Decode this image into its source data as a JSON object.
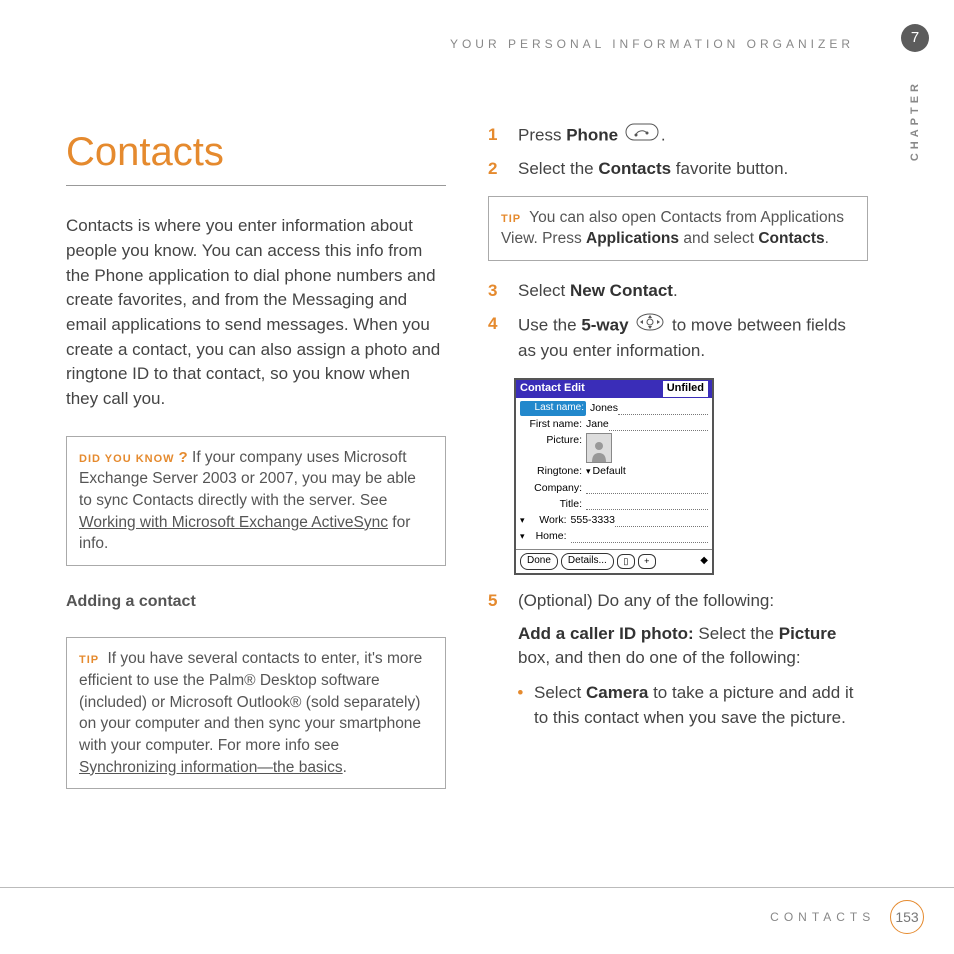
{
  "header": {
    "running_head": "YOUR PERSONAL INFORMATION ORGANIZER",
    "chapter_number": "7",
    "chapter_label": "CHAPTER"
  },
  "left": {
    "title": "Contacts",
    "intro": "Contacts is where you enter information about people you know. You can access this info from the Phone application to dial phone numbers and create favorites, and from the Messaging and email applications to send messages. When you create a contact, you can also assign a photo and ringtone ID to that contact, so you know when they call you.",
    "dyk_tag": "DID YOU KNOW",
    "dyk_text_pre": "If your company uses Microsoft Exchange Server 2003 or 2007, you may be able to sync Contacts directly with the server. See ",
    "dyk_link": "Working with Microsoft Exchange ActiveSync",
    "dyk_after": " for info.",
    "subhead": "Adding a contact",
    "tip_tag": "TIP",
    "tip_text_pre": "If you have several contacts to enter, it's more efficient to use the Palm® Desktop software (included) or Microsoft Outlook® (sold separately) on your computer and then sync your smartphone with your computer. For more info see ",
    "tip_link": "Synchronizing information—the basics",
    "tip_after": "."
  },
  "right": {
    "s1_a": "Press ",
    "s1_b": "Phone",
    "s1_c": ".",
    "s2_a": "Select the ",
    "s2_b": "Contacts",
    "s2_c": " favorite button.",
    "tipbox_tag": "TIP",
    "tipbox_a": "You can also open Contacts from Applications View. Press ",
    "tipbox_b": "Applications",
    "tipbox_c": " and select ",
    "tipbox_d": "Contacts",
    "tipbox_e": ".",
    "s3_a": "Select ",
    "s3_b": "New Contact",
    "s3_c": ".",
    "s4_a": "Use the ",
    "s4_b": "5-way",
    "s4_c": " to move between fields as you enter information.",
    "s5_a": "(Optional)  Do any of the following:",
    "s5_h1": "Add a caller ID photo:",
    "s5_h1_rest": " Select the ",
    "s5_h1_b": "Picture",
    "s5_h1_after": " box, and then do one of the following:",
    "bullet1_a": "Select ",
    "bullet1_b": "Camera",
    "bullet1_c": " to take a picture and add it to this contact when you save the picture."
  },
  "palm": {
    "title": "Contact Edit",
    "category": "Unfiled",
    "lastname_lbl": "Last name:",
    "lastname_val": "Jones",
    "firstname_lbl": "First name:",
    "firstname_val": "Jane",
    "picture_lbl": "Picture:",
    "ringtone_lbl": "Ringtone:",
    "ringtone_val": "Default",
    "company_lbl": "Company:",
    "title_lbl": "Title:",
    "work_lbl": "Work:",
    "work_val": "555-3333",
    "home_lbl": "Home:",
    "done": "Done",
    "details": "Details..."
  },
  "footer": {
    "label": "CONTACTS",
    "page": "153"
  }
}
